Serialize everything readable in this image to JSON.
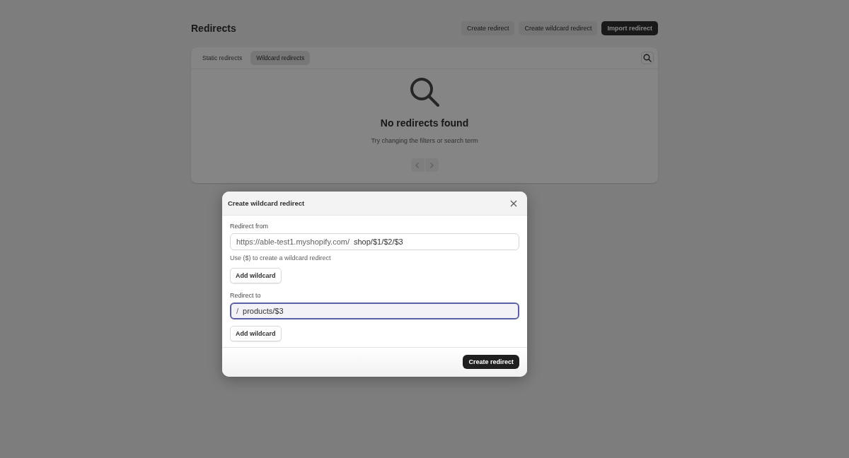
{
  "page": {
    "title": "Redirects",
    "actions": [
      {
        "label": "Create redirect",
        "kind": "secondary"
      },
      {
        "label": "Create wildcard redirect",
        "kind": "secondary"
      },
      {
        "label": "Import redirect",
        "kind": "primary"
      }
    ]
  },
  "tabs": [
    {
      "label": "Static redirects",
      "selected": false
    },
    {
      "label": "Wildcard redirects",
      "selected": true
    }
  ],
  "empty_state": {
    "title": "No redirects found",
    "message": "Try changing the filters or search term"
  },
  "pagination": {
    "previous": {
      "disabled": true
    },
    "next": {
      "disabled": true
    }
  },
  "dialog": {
    "title": "Create wildcard redirect",
    "fields": [
      {
        "label": "Redirect from",
        "prefix": "https://able-test1.myshopify.com/",
        "value": "shop/$1/$2/$3",
        "help": "Use ($) to create a wildcard redirect",
        "button": "Add wildcard",
        "focused": false
      },
      {
        "label": "Redirect to",
        "prefix": "/",
        "value": "products/$3",
        "button": "Add wildcard",
        "focused": true
      }
    ],
    "submit": "Create redirect"
  }
}
